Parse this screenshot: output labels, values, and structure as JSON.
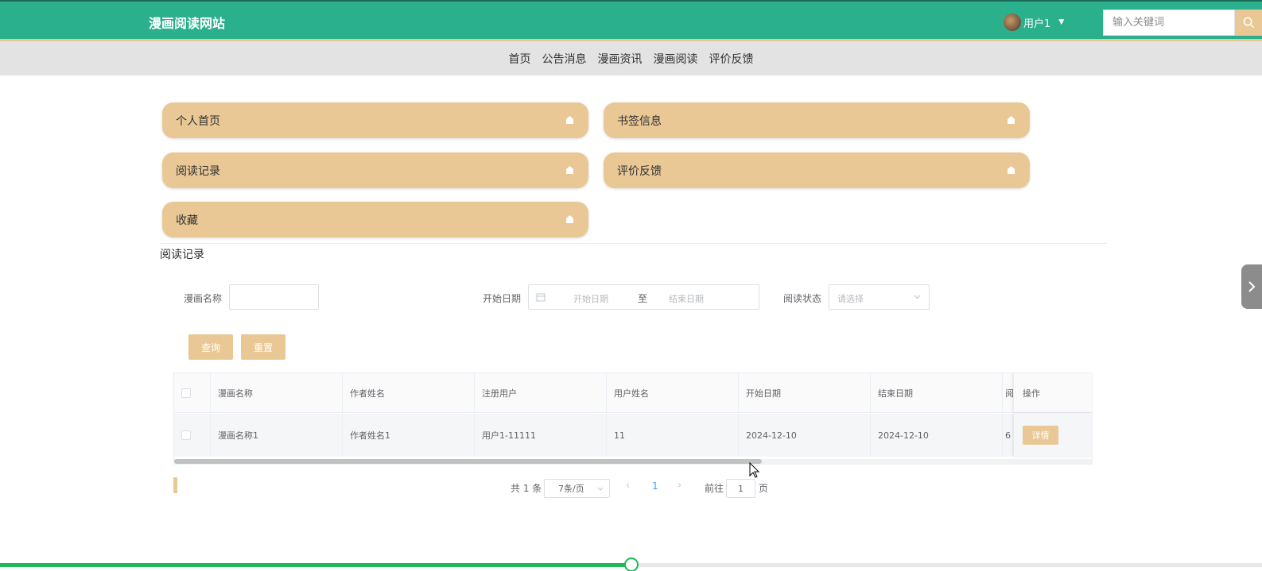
{
  "header": {
    "site_title": "漫画阅读网站",
    "user_name": "用户1",
    "search_placeholder": "输入关键词"
  },
  "nav": {
    "items": [
      "首页",
      "公告消息",
      "漫画资讯",
      "漫画阅读",
      "评价反馈"
    ]
  },
  "menu": {
    "items": [
      "个人首页",
      "书签信息",
      "阅读记录",
      "评价反馈",
      "收藏"
    ]
  },
  "section": {
    "title": "阅读记录"
  },
  "filters": {
    "name_label": "漫画名称",
    "date_label": "开始日期",
    "date_start_placeholder": "开始日期",
    "date_separator": "至",
    "date_end_placeholder": "结束日期",
    "status_label": "阅读状态",
    "status_placeholder": "请选择",
    "search_button": "查询",
    "reset_button": "重置"
  },
  "table": {
    "columns": [
      "漫画名称",
      "作者姓名",
      "注册用户",
      "用户姓名",
      "开始日期",
      "结束日期"
    ],
    "operation_header": "操作",
    "rows": [
      {
        "cells": [
          "漫画名称1",
          "作者姓名1",
          "用户1-11111",
          "11",
          "2024-12-10",
          "2024-12-10"
        ],
        "truncated": "6",
        "action": "详情"
      }
    ],
    "overflow_header": "阅"
  },
  "pagination": {
    "total": "共 1 条",
    "page_size": "7条/页",
    "current_page": "1",
    "goto_label": "前往",
    "goto_value": "1",
    "page_unit": "页"
  },
  "video": {
    "progress": 0.5
  },
  "colors": {
    "header": "#2bb08e",
    "accent": "#e9c895",
    "nav_bg": "#e3e3e3"
  }
}
